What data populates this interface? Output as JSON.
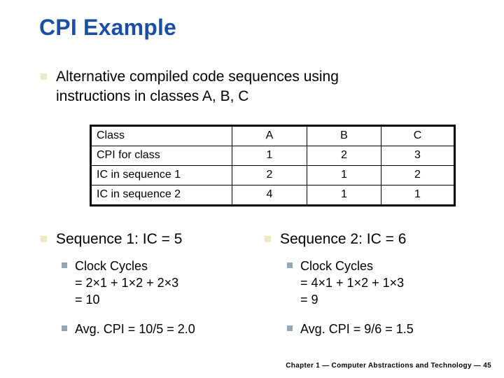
{
  "slide": {
    "title": "CPI Example",
    "title_color": "#1B4FA5",
    "background": "#FFFFFF",
    "bullet_level1_color": "#EDEBC6",
    "bullet_level2_color": "#8EA7BC"
  },
  "intro": {
    "line1": "Alternative compiled code sequences using",
    "line2": "instructions in classes A, B, C"
  },
  "table": {
    "headers": [
      "Class",
      "A",
      "B",
      "C"
    ],
    "rows": [
      {
        "label": "CPI for class",
        "values": [
          "1",
          "2",
          "3"
        ]
      },
      {
        "label": "IC in sequence 1",
        "values": [
          "2",
          "1",
          "2"
        ]
      },
      {
        "label": "IC in sequence 2",
        "values": [
          "4",
          "1",
          "1"
        ]
      }
    ]
  },
  "sequences": [
    {
      "heading": "Sequence 1: IC = 5",
      "sub": [
        {
          "line1": "Clock Cycles",
          "line2": "= 2×1 + 1×2 + 2×3",
          "line3": "= 10"
        },
        {
          "line1": "Avg. CPI = 10/5 = 2.0",
          "line2": "",
          "line3": ""
        }
      ]
    },
    {
      "heading": "Sequence 2: IC = 6",
      "sub": [
        {
          "line1": "Clock Cycles",
          "line2": "= 4×1 + 1×2 + 1×3",
          "line3": "= 9"
        },
        {
          "line1": "Avg. CPI = 9/6 = 1.5",
          "line2": "",
          "line3": ""
        }
      ]
    }
  ],
  "footer": {
    "text": "Chapter 1 — Computer Abstractions and Technology — 45"
  },
  "chart_data": {
    "type": "table",
    "title": "CPI Example",
    "categories": [
      "A",
      "B",
      "C"
    ],
    "series": [
      {
        "name": "CPI for class",
        "values": [
          1,
          2,
          3
        ]
      },
      {
        "name": "IC in sequence 1",
        "values": [
          2,
          1,
          2
        ]
      },
      {
        "name": "IC in sequence 2",
        "values": [
          4,
          1,
          1
        ]
      }
    ],
    "derived": [
      {
        "name": "Sequence 1 IC",
        "value": 5
      },
      {
        "name": "Sequence 1 Clock Cycles",
        "value": 10
      },
      {
        "name": "Sequence 1 Avg CPI",
        "value": 2.0
      },
      {
        "name": "Sequence 2 IC",
        "value": 6
      },
      {
        "name": "Sequence 2 Clock Cycles",
        "value": 9
      },
      {
        "name": "Sequence 2 Avg CPI",
        "value": 1.5
      }
    ]
  }
}
